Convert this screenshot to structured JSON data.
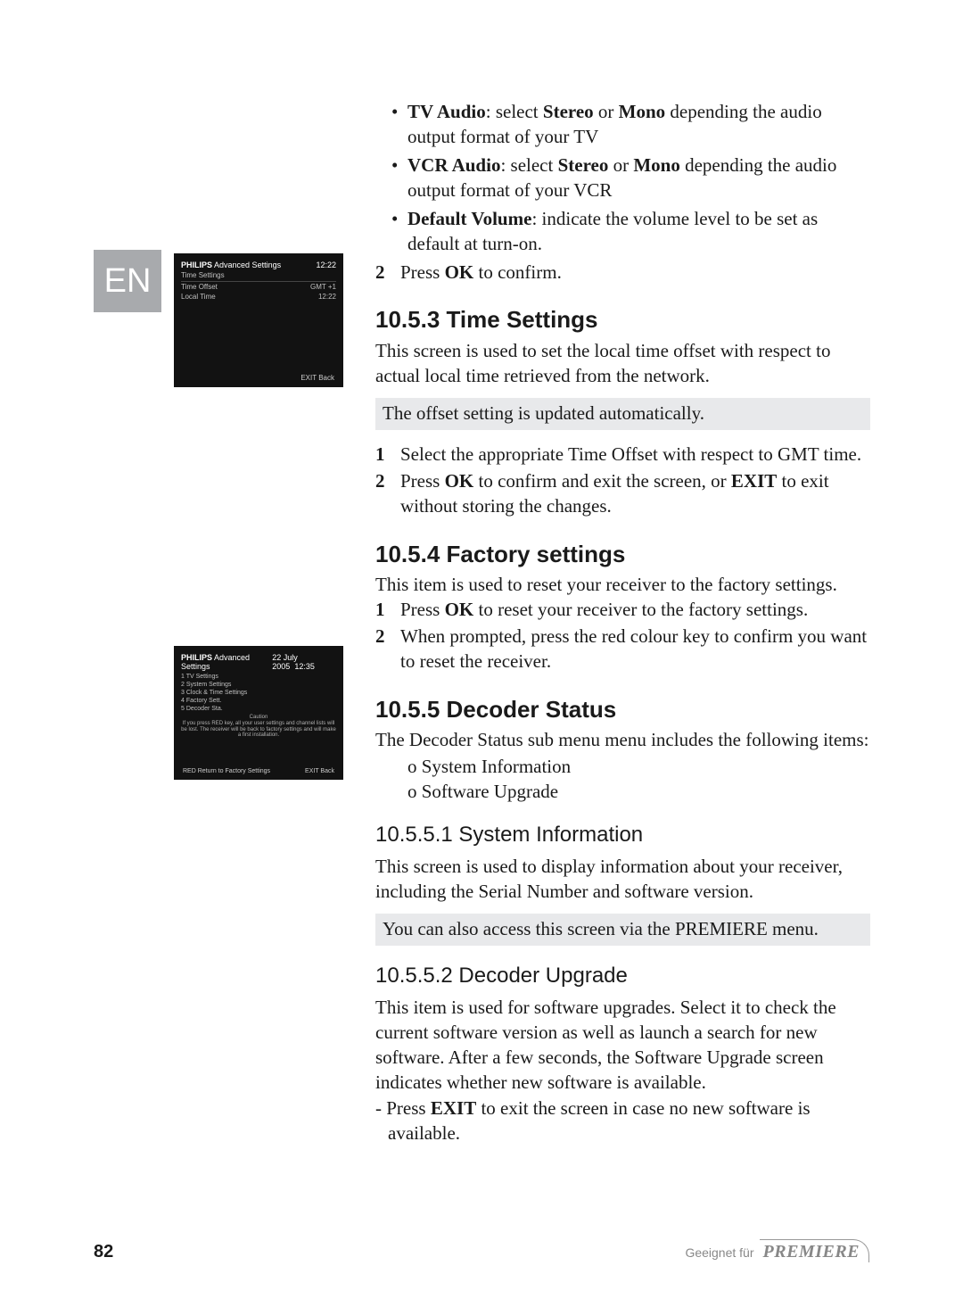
{
  "lang": "EN",
  "screenshot1": {
    "brand": "PHILIPS",
    "screen": "Advanced Settings",
    "time": "12:22",
    "subtitle": "Time Settings",
    "row1_label": "Time Offset",
    "row1_value": "GMT +1",
    "row2_label": "Local Time",
    "row2_value": "12:22",
    "foot": "EXIT  Back"
  },
  "screenshot2": {
    "brand": "PHILIPS",
    "screen": "Advanced Settings",
    "date": "22 July 2005",
    "time": "12:35",
    "items": {
      "i1": "1   TV Settings",
      "i2": "2   System Settings",
      "i3": "3   Clock & Time Settings",
      "i4": "4   Factory Sett.",
      "i5": "5   Decoder Sta."
    },
    "caution_title": "Caution",
    "caution_body": "If you press RED key, all your user settings and channel lists will be lost. The receiver will be back to factory settings and will make a first installation.",
    "foot_left": "RED  Return to Factory Settings",
    "foot_right": "EXIT  Back"
  },
  "body": {
    "tv_audio_bold": "TV Audio",
    "tv_audio_rest": ": select ",
    "stereo": "Stereo",
    "or": " or ",
    "mono": "Mono",
    "tv_audio_tail": " depending the audio output format of your TV",
    "vcr_audio_bold": "VCR Audio",
    "vcr_audio_rest": ": select ",
    "vcr_audio_tail": " depending the audio output format of your VCR",
    "def_vol_bold": "Default Volume",
    "def_vol_rest": ": indicate the volume level to be set as default at turn-on.",
    "step2_press": "Press ",
    "ok": "OK",
    "step2_tail": " to confirm.",
    "h_1053": "10.5.3 Time Settings",
    "p_1053": "This screen is used to set the local time offset with respect to actual local time retrieved from the network.",
    "note_1053": "The offset setting is updated automatically.",
    "s1053_1": "Select the appropriate Time Offset with respect to GMT time.",
    "s1053_2a": "Press ",
    "s1053_2b": " to confirm and exit the screen, or ",
    "exit": "EXIT",
    "s1053_2c": " to exit without storing the changes.",
    "h_1054": "10.5.4 Factory settings",
    "p_1054": "This item is used to reset your receiver to the factory settings.",
    "s1054_1a": "Press ",
    "s1054_1b": " to reset your receiver to the factory settings.",
    "s1054_2": "When prompted, press the red colour key to confirm you want to reset the receiver.",
    "h_1055": "10.5.5 Decoder Status",
    "p_1055": "The Decoder Status sub menu menu includes the following items:",
    "sub1": "o System Information",
    "sub2": "o Software Upgrade",
    "h_10551": "10.5.5.1  System Information",
    "p_10551": "This screen is used to display information about your receiver, including the Serial Number and software version.",
    "note_10551": "You can also access this screen via the PREMIERE menu.",
    "h_10552": "10.5.5.2  Decoder Upgrade",
    "p_10552": "This item is used for software upgrades. Select it to check the current software version as well as launch a search for new software. After a few seconds, the Software Upgrade screen indicates whether new software is available.",
    "p_10552_dash": "-  Press ",
    "p_10552_tail": " to exit the screen in case no new software is available."
  },
  "footer": {
    "page": "82",
    "suitable": "Geeignet für",
    "brand": "PREMIERE"
  }
}
